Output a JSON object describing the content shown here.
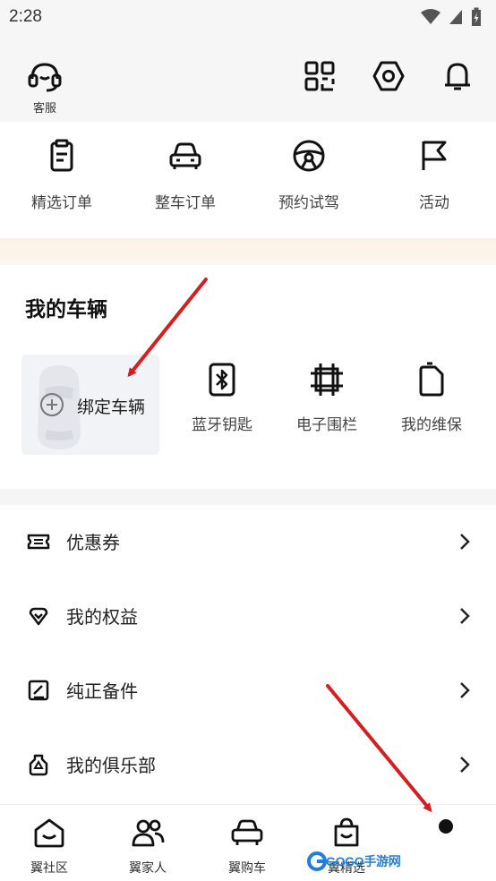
{
  "status": {
    "time": "2:28"
  },
  "header": {
    "service_label": "客服"
  },
  "quick_actions": [
    {
      "label": "精选订单",
      "icon": "clipboard-icon"
    },
    {
      "label": "整车订单",
      "icon": "car-front-icon"
    },
    {
      "label": "预约试驾",
      "icon": "steering-wheel-icon"
    },
    {
      "label": "活动",
      "icon": "flag-icon"
    }
  ],
  "vehicle": {
    "title": "我的车辆",
    "bind_label": "绑定车辆",
    "features": [
      {
        "label": "蓝牙钥匙",
        "icon": "bluetooth-icon"
      },
      {
        "label": "电子围栏",
        "icon": "fence-icon"
      },
      {
        "label": "我的维保",
        "icon": "maintenance-icon"
      }
    ]
  },
  "menu": [
    {
      "label": "优惠券",
      "icon": "ticket-icon"
    },
    {
      "label": "我的权益",
      "icon": "diamond-icon"
    },
    {
      "label": "纯正备件",
      "icon": "parts-icon"
    },
    {
      "label": "我的俱乐部",
      "icon": "club-icon"
    }
  ],
  "tabs": [
    {
      "label": "翼社区",
      "icon": "community-icon"
    },
    {
      "label": "翼家人",
      "icon": "people-icon"
    },
    {
      "label": "翼购车",
      "icon": "car-icon"
    },
    {
      "label": "翼精选",
      "icon": "shopping-bag-icon"
    }
  ],
  "watermark": {
    "text": "GOGO手游网"
  },
  "colors": {
    "accent_arrow": "#d61e1e",
    "peach_band": "#fbf1e6",
    "watermark_blue": "#1e7fe0"
  }
}
